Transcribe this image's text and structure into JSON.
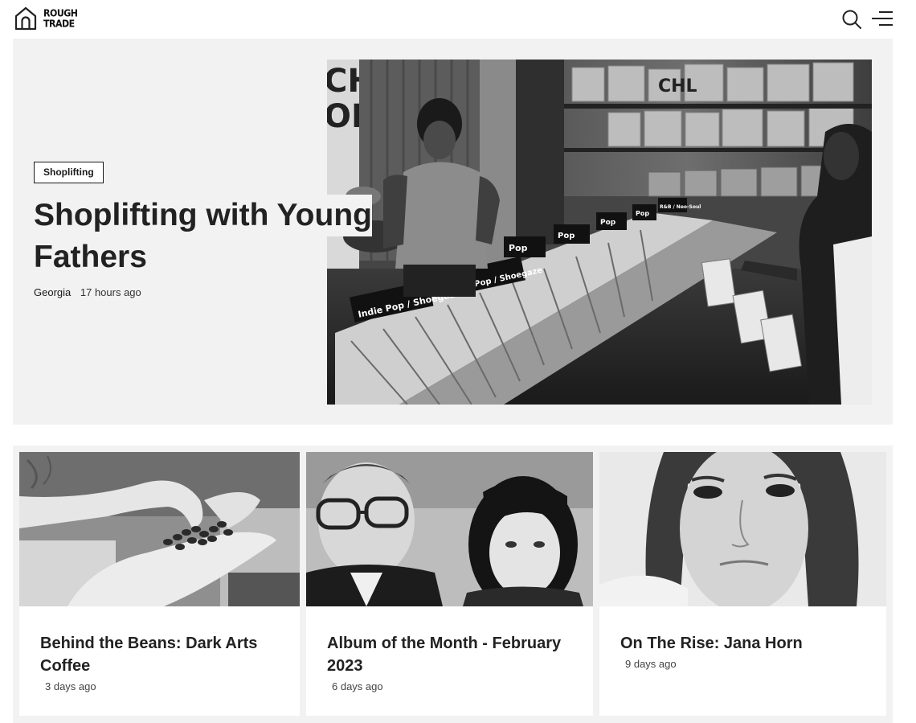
{
  "header": {
    "logo_line1": "ROUGH",
    "logo_line2": "TRADE",
    "search_icon": "search-icon",
    "menu_icon": "menu-icon"
  },
  "hero": {
    "tag": "Shoplifting",
    "title_line1": "Shoplifting with Young",
    "title_line2": "Fathers",
    "author": "Georgia",
    "time": "17 hours ago",
    "photo_signs": [
      "Indie Pop / Shoegaze",
      "Indie Pop / Shoegaze",
      "Pop",
      "Pop",
      "Pop",
      "Pop",
      "R&B / Neo-Soul"
    ]
  },
  "cards": [
    {
      "title": "Behind the Beans: Dark Arts Coffee",
      "time": "3 days ago"
    },
    {
      "title": "Album of the Month - February 2023",
      "time": "6 days ago"
    },
    {
      "title": "On The Rise: Jana Horn",
      "time": "9 days ago"
    }
  ],
  "colors": {
    "panel_bg": "#f2f2f2",
    "text": "#1a1a1a"
  }
}
